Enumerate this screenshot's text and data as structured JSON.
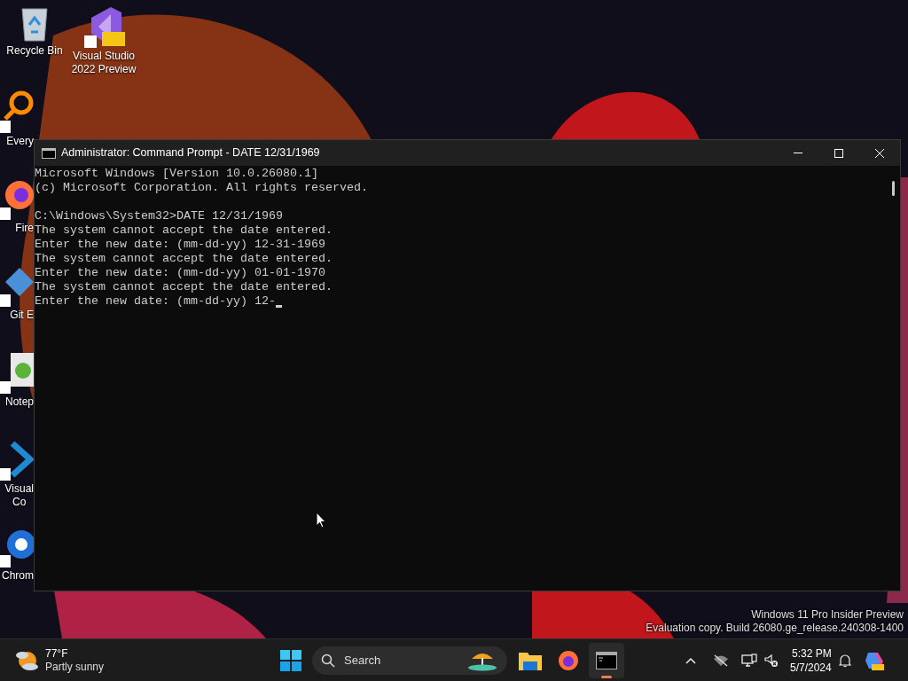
{
  "desktop_icons": [
    {
      "kind": "recycle",
      "lines": [
        "Recycle Bin"
      ]
    },
    {
      "kind": "vs",
      "lines": [
        "Visual Studio",
        "2022 Preview"
      ]
    },
    {
      "kind": "everything",
      "lines": [
        "Every"
      ]
    },
    {
      "kind": "firefox",
      "lines": [
        "Fire"
      ]
    },
    {
      "kind": "git",
      "lines": [
        "Git E"
      ]
    },
    {
      "kind": "notepad",
      "lines": [
        "Notep"
      ]
    },
    {
      "kind": "vscode",
      "lines": [
        "Visual",
        "Co"
      ]
    },
    {
      "kind": "chrome",
      "lines": [
        "Chrom"
      ]
    }
  ],
  "window": {
    "title": "Administrator: Command Prompt - DATE  12/31/1969",
    "banner": [
      "Microsoft Windows [Version 10.0.26080.1]",
      "(c) Microsoft Corporation. All rights reserved."
    ],
    "lines": [
      "C:\\Windows\\System32>DATE 12/31/1969",
      "The system cannot accept the date entered.",
      "Enter the new date: (mm-dd-yy) 12-31-1969",
      "The system cannot accept the date entered.",
      "Enter the new date: (mm-dd-yy) 01-01-1970",
      "The system cannot accept the date entered.",
      "Enter the new date: (mm-dd-yy) 12-"
    ]
  },
  "watermark": [
    "Windows 11 Pro Insider Preview",
    "Evaluation copy. Build 26080.ge_release.240308-1400"
  ],
  "taskbar": {
    "weather": {
      "temperature": "77°F",
      "condition": "Partly sunny"
    },
    "search": {
      "placeholder": "Search"
    },
    "apps": [
      {
        "kind": "explorer",
        "running": false
      },
      {
        "kind": "firefox",
        "running": false
      },
      {
        "kind": "terminal",
        "running": true
      }
    ],
    "time": "5:32 PM",
    "date": "5/7/2024"
  }
}
